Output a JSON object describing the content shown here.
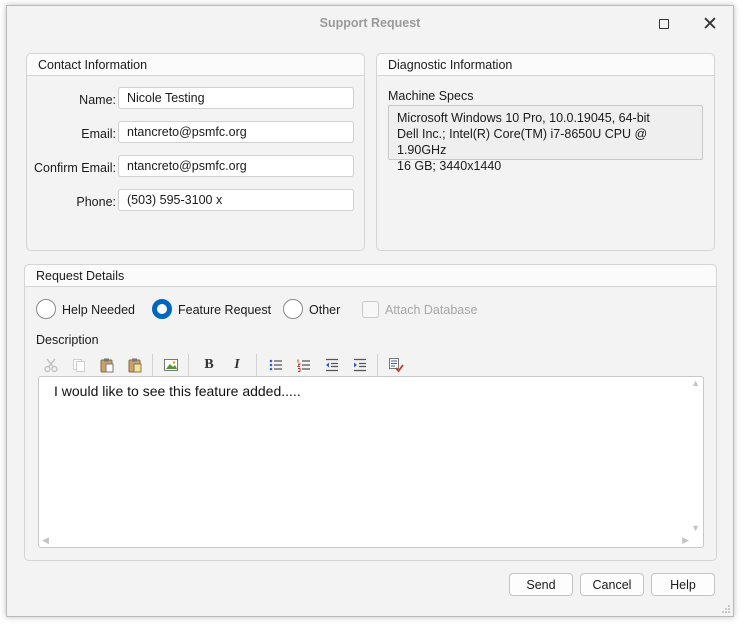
{
  "window": {
    "title": "Support Request"
  },
  "contact": {
    "title": "Contact Information",
    "name_label": "Name:",
    "name_value": "Nicole Testing",
    "email_label": "Email:",
    "email_value": "ntancreto@psmfc.org",
    "confirm_label": "Confirm Email:",
    "confirm_value": "ntancreto@psmfc.org",
    "phone_label": "Phone:",
    "phone_value": "(503) 595-3100 x"
  },
  "diagnostic": {
    "title": "Diagnostic Information",
    "specs_label": "Machine Specs",
    "specs_lines": [
      "Microsoft Windows 10 Pro, 10.0.19045, 64-bit",
      "Dell Inc.; Intel(R) Core(TM) i7-8650U CPU @ 1.90GHz",
      "16 GB; 3440x1440"
    ]
  },
  "request": {
    "title": "Request Details",
    "options": [
      {
        "label": "Help Needed",
        "checked": false
      },
      {
        "label": "Feature Request",
        "checked": true
      },
      {
        "label": "Other",
        "checked": false
      }
    ],
    "attach_label": "Attach Database",
    "attach_checked": false,
    "attach_disabled": true,
    "description_label": "Description",
    "description_text": "I would like to see this feature added.....",
    "toolbar_icons": [
      "cut-icon",
      "copy-icon",
      "paste-icon",
      "paste-special-icon",
      "insert-image-icon",
      "bold-icon",
      "italic-icon",
      "bulleted-list-icon",
      "numbered-list-icon",
      "outdent-icon",
      "indent-icon",
      "spell-check-icon"
    ]
  },
  "buttons": {
    "send": "Send",
    "cancel": "Cancel",
    "help": "Help"
  },
  "colors": {
    "accent": "#0067c0",
    "title_text": "#9a9a9a",
    "disabled_text": "#a7a7a7"
  }
}
